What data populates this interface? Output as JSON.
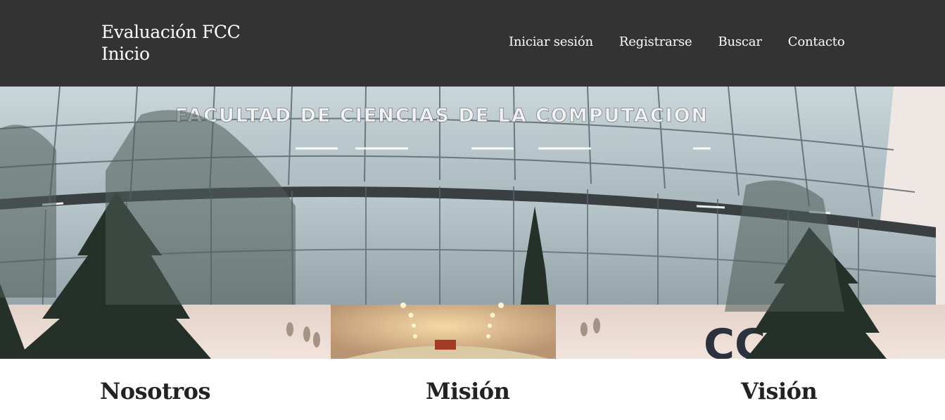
{
  "header": {
    "brand_line1": "Evaluación FCC",
    "brand_line2": "Inicio",
    "background": "#333333"
  },
  "nav": {
    "items": [
      {
        "label": "Iniciar sesión"
      },
      {
        "label": "Registrarse"
      },
      {
        "label": "Buscar"
      },
      {
        "label": "Contacto"
      }
    ]
  },
  "hero": {
    "building_sign": "FACULTAD DE CIENCIAS DE LA COMPUTACION",
    "logo_text": "CCC"
  },
  "sections": {
    "items": [
      {
        "title": "Nosotros"
      },
      {
        "title": "Misión"
      },
      {
        "title": "Visión"
      }
    ]
  }
}
